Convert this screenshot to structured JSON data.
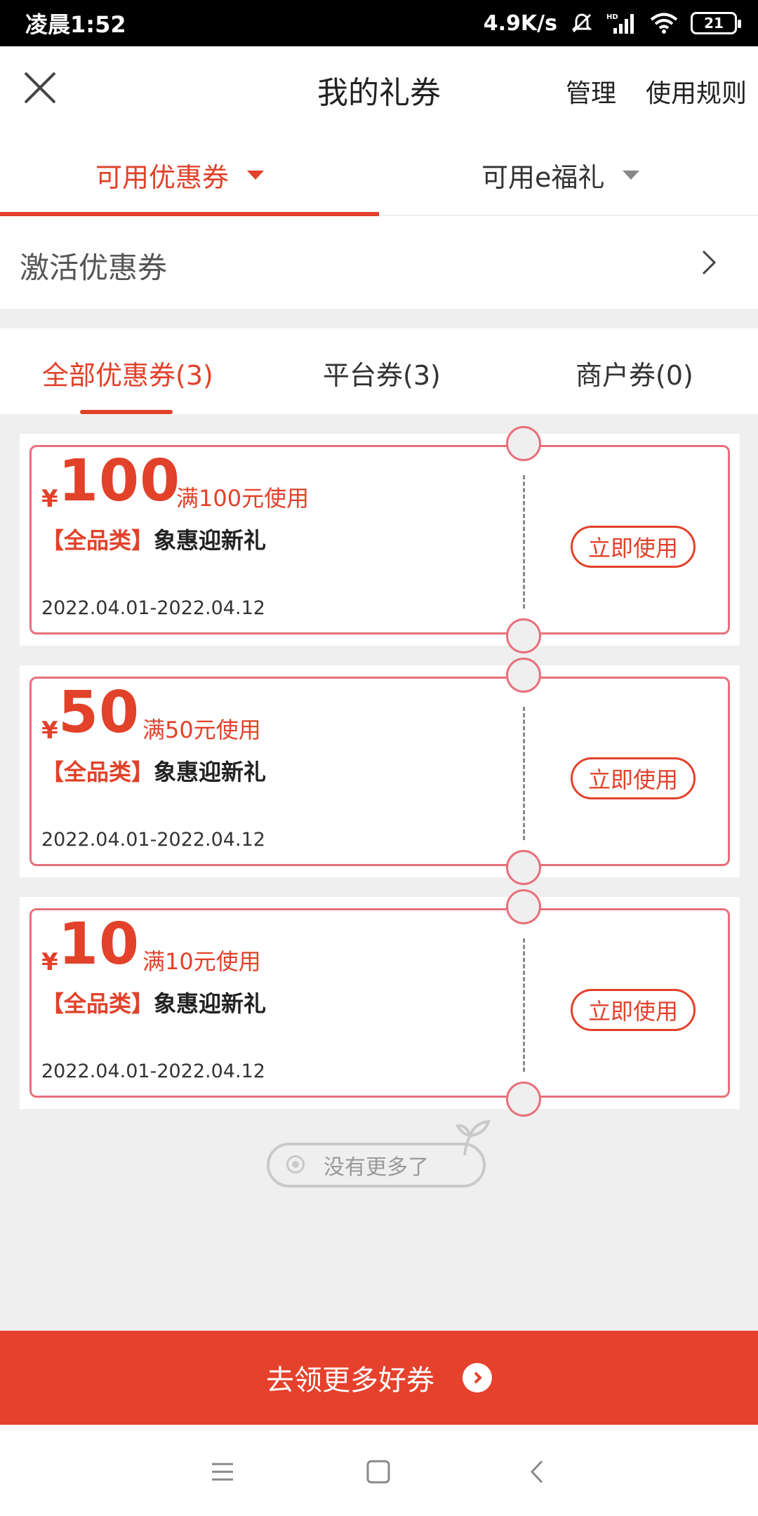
{
  "status_bar": {
    "time": "凌晨1:52",
    "network_speed": "4.9K/s",
    "battery": "21",
    "icons": [
      "mute-bell-icon",
      "hd-signal-icon",
      "wifi-icon",
      "battery-icon"
    ]
  },
  "header": {
    "title": "我的礼券",
    "manage_label": "管理",
    "rules_label": "使用规则",
    "close_icon": "close-icon"
  },
  "top_tabs": [
    {
      "label": "可用优惠券",
      "active": true
    },
    {
      "label": "可用e福礼",
      "active": false
    }
  ],
  "activate": {
    "label": "激活优惠券"
  },
  "sub_tabs": [
    {
      "label": "全部优惠券(3)",
      "active": true
    },
    {
      "label": "平台券(3)",
      "active": false
    },
    {
      "label": "商户券(0)",
      "active": false
    }
  ],
  "coupons": [
    {
      "currency": "¥",
      "amount": "100",
      "condition": "满100元使用",
      "category": "【全品类】",
      "name": "象惠迎新礼",
      "dates": "2022.04.01-2022.04.12",
      "button": "立即使用"
    },
    {
      "currency": "¥",
      "amount": "50",
      "condition": "满50元使用",
      "category": "【全品类】",
      "name": "象惠迎新礼",
      "dates": "2022.04.01-2022.04.12",
      "button": "立即使用"
    },
    {
      "currency": "¥",
      "amount": "10",
      "condition": "满10元使用",
      "category": "【全品类】",
      "name": "象惠迎新礼",
      "dates": "2022.04.01-2022.04.12",
      "button": "立即使用"
    }
  ],
  "no_more": "没有更多了",
  "cta": {
    "label": "去领更多好券"
  },
  "colors": {
    "accent": "#e2412a",
    "coupon_border": "#e8707a",
    "cta_bg": "#e5412c"
  }
}
